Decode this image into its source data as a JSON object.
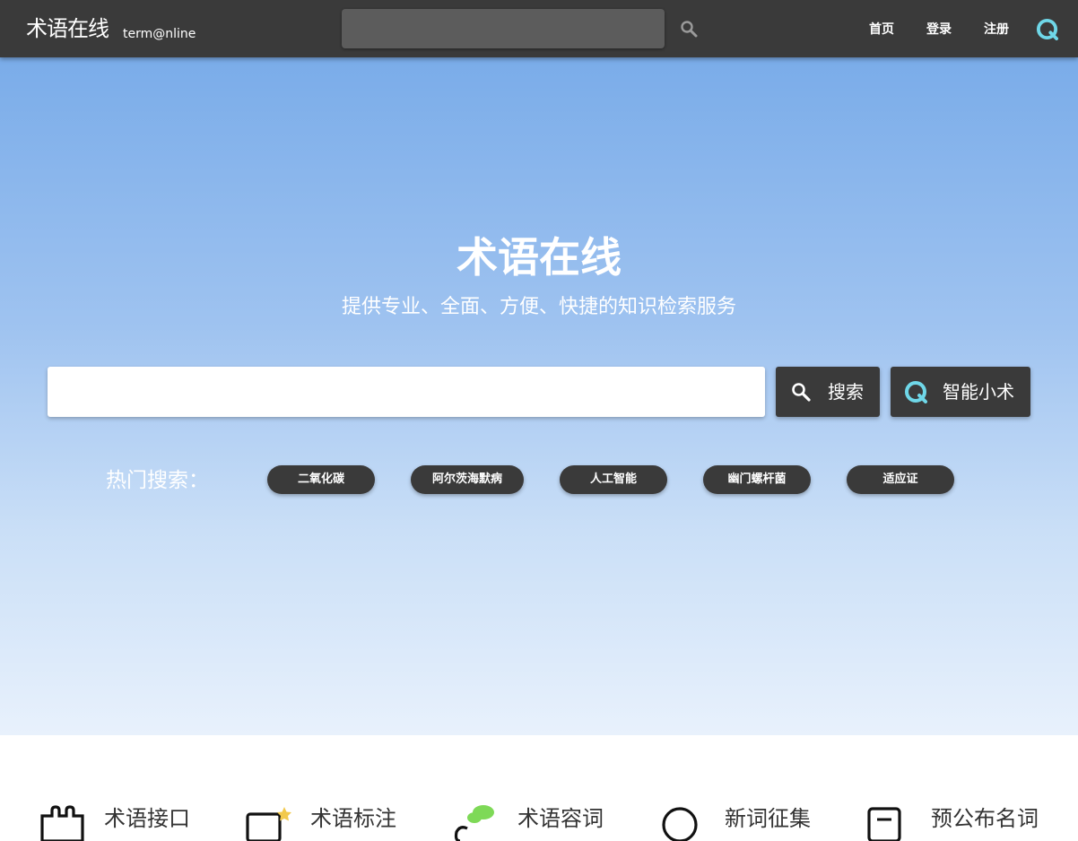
{
  "navbar": {
    "logo_cn": "术语在线",
    "logo_en": "term@nline",
    "search_placeholder": "",
    "links": [
      {
        "label": "首页"
      },
      {
        "label": "登录"
      },
      {
        "label": "注册"
      }
    ],
    "icons": {
      "search": "search-icon",
      "ai": "ai-assistant-icon"
    }
  },
  "hero": {
    "title": "术语在线",
    "subtitle": "提供专业、全面、方便、快捷的知识检索服务",
    "search_placeholder": "",
    "search_button": "搜索",
    "ai_button": "智能小术",
    "hot_label": "热门搜索：",
    "hot_tags": [
      "二氧化碳",
      "阿尔茨海默病",
      "人工智能",
      "幽门螺杆菌",
      "适应证"
    ]
  },
  "features": [
    {
      "label": "术语接口",
      "icon": "puzzle-icon"
    },
    {
      "label": "术语标注",
      "icon": "annotate-icon"
    },
    {
      "label": "术语容词",
      "icon": "cloud-icon"
    },
    {
      "label": "新词征集",
      "icon": "circle-icon"
    },
    {
      "label": "预公布名词",
      "icon": "document-icon"
    }
  ],
  "colors": {
    "navbar_bg": "#3a3a3a",
    "hero_top": "#7aace9",
    "hero_bottom": "#e8f1fc",
    "accent": "#6fd7e8",
    "button_dark": "#3a3a3a"
  }
}
